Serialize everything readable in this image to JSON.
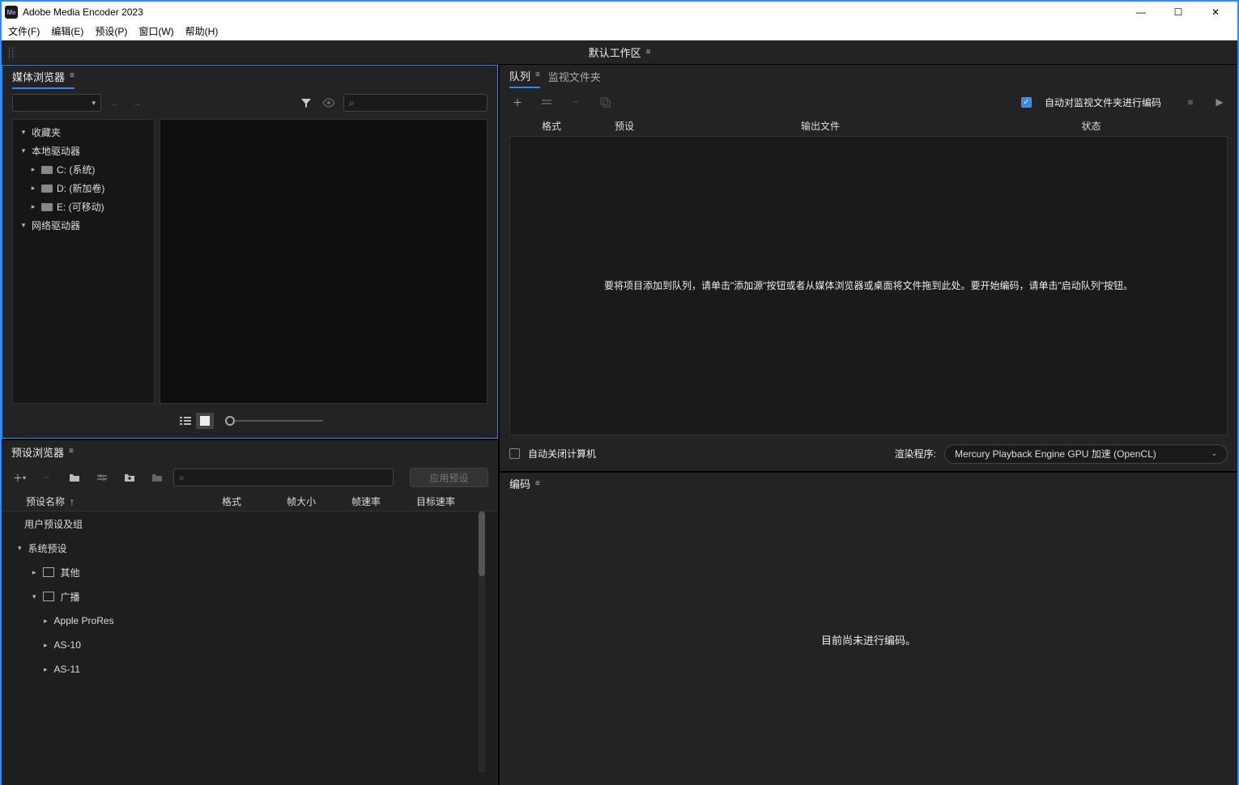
{
  "titlebar": {
    "app_abbrev": "Me",
    "title": "Adobe Media Encoder 2023"
  },
  "menubar": {
    "file": "文件(F)",
    "edit": "编辑(E)",
    "preset": "预设(P)",
    "window": "窗口(W)",
    "help": "帮助(H)"
  },
  "workspace": {
    "label": "默认工作区"
  },
  "media_browser": {
    "title": "媒体浏览器",
    "tree": {
      "favorites": "收藏夹",
      "local_drives": "本地驱动器",
      "drive_c": "C: (系统)",
      "drive_d": "D: (新加卷)",
      "drive_e": "E: (可移动)",
      "network_drives": "网络驱动器"
    }
  },
  "preset_browser": {
    "title": "预设浏览器",
    "apply": "应用预设",
    "cols": {
      "name": "预设名称",
      "format": "格式",
      "framesize": "帧大小",
      "framerate": "帧速率",
      "bitrate": "目标速率"
    },
    "rows": {
      "user": "用户预设及组",
      "system": "系统预设",
      "other": "其他",
      "broadcast": "广播",
      "apple": "Apple ProRes",
      "as10": "AS-10",
      "as11": "AS-11"
    }
  },
  "queue": {
    "tab_queue": "队列",
    "tab_watch": "监视文件夹",
    "auto_encode": "自动对监视文件夹进行编码",
    "cols": {
      "format": "格式",
      "preset": "预设",
      "output": "输出文件",
      "status": "状态"
    },
    "empty_msg": "要将项目添加到队列，请单击\"添加源\"按钮或者从媒体浏览器或桌面将文件拖到此处。要开始编码，请单击\"启动队列\"按钮。",
    "auto_shutdown": "自动关闭计算机",
    "renderer_label": "渲染程序:",
    "renderer_value": "Mercury Playback Engine GPU 加速 (OpenCL)"
  },
  "encoding": {
    "title": "编码",
    "idle": "目前尚未进行编码。"
  },
  "glyph": {
    "minimize": "—",
    "maximize": "☐",
    "close": "✕",
    "chev_down": "⌄",
    "chev_right": "›",
    "chev_left": "‹",
    "funnel": "▼",
    "eye": "👁",
    "search": "⌕",
    "plus": "＋",
    "minus": "−",
    "list": "≣",
    "grid": "■",
    "sort_up": "↑",
    "stop": "■",
    "play": "▶"
  }
}
